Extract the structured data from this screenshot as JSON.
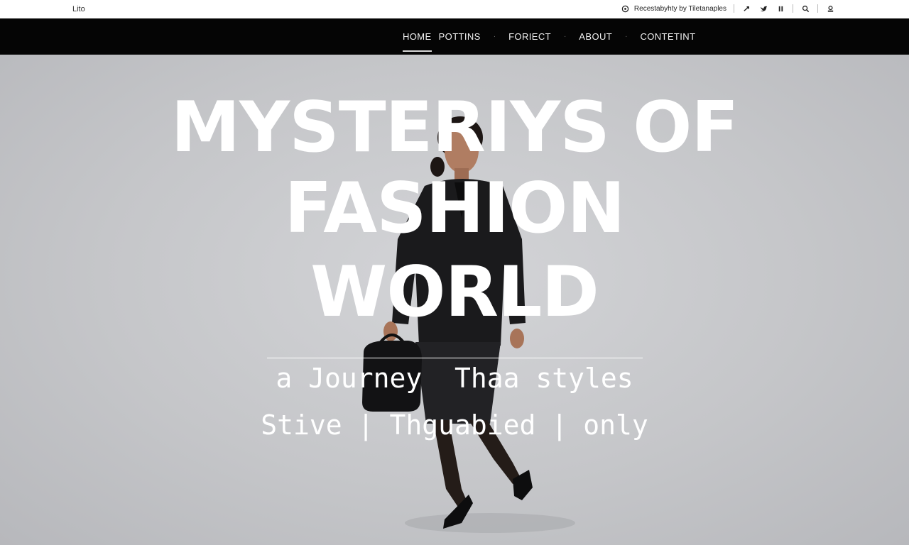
{
  "utility_bar": {
    "logo": "Lito",
    "credit": "Recestabyhty by Tiletanaples",
    "icons": [
      "share-icon",
      "twitter-icon",
      "pinterest-icon",
      "search-icon",
      "user-icon"
    ]
  },
  "nav": {
    "items": [
      {
        "label": "HOME",
        "active": true
      },
      {
        "label": "POTTINS",
        "active": false
      },
      {
        "label": "FORIECT",
        "active": false
      },
      {
        "label": "ABOUT",
        "active": false
      },
      {
        "label": "CONTETINT",
        "active": false
      }
    ]
  },
  "hero": {
    "title_line_1": "MYSTERIYS OF",
    "title_line_2": "FASHION",
    "title_line_3": "WORLD",
    "subtitle": "a Journey  Thaa styles",
    "tags": [
      "Stive",
      "Thguabied",
      "only"
    ]
  },
  "colors": {
    "nav_bg": "#050505",
    "hero_bg": "#c9cacd",
    "text_light": "#ffffff"
  }
}
